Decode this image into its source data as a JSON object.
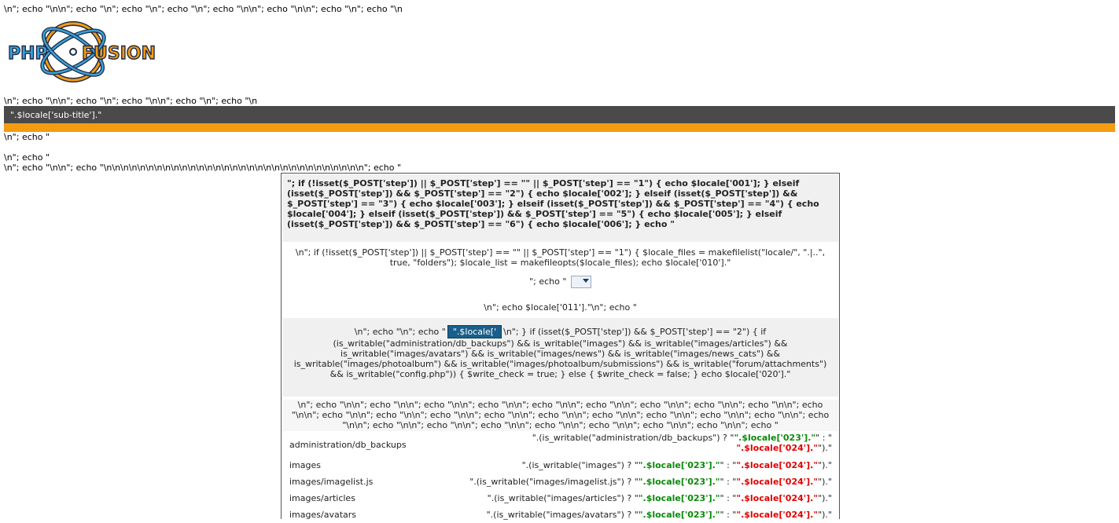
{
  "header": {
    "echo_line_1": "\\n\"; echo \"\\n\\n\"; echo \"\\n\"; echo \"\\n\"; echo \"\\n\"; echo \"\\n\\n\"; echo \"\\n\\n\"; echo \"\\n\"; echo \"\\n",
    "echo_line_2": "\\n\"; echo \"\\n\\n\"; echo \"\\n\"; echo \"\\n\\n\"; echo \"\\n\"; echo \"\\n",
    "logo_text_left": "PHP",
    "logo_text_right": "FUSION",
    "subtitle": "\".$locale['sub-title'].\"",
    "echo_line_3": "\\n\"; echo \"",
    "echo_line_4": "\\n\"; echo \"",
    "echo_line_5": "\\n\"; echo \"\\n\\n\"; echo \"\\n\\n\\n\\n\\n\\n\\n\\n\\n\\n\\n\\n\\n\\n\\n\\n\\n\\n\\n\\n\\n\\n\\n\\n\\n\\n\\n\\n\\n\\n\\n\"; echo \""
  },
  "panel": {
    "title": "\"; if (!isset($_POST['step']) || $_POST['step'] == \"\" || $_POST['step'] == \"1\") { echo $locale['001']; } elseif (isset($_POST['step']) && $_POST['step'] == \"2\") { echo $locale['002']; } elseif (isset($_POST['step']) && $_POST['step'] == \"3\") { echo $locale['003']; } elseif (isset($_POST['step']) && $_POST['step'] == \"4\") { echo $locale['004']; } elseif (isset($_POST['step']) && $_POST['step'] == \"5\") { echo $locale['005']; } elseif (isset($_POST['step']) && $_POST['step'] == \"6\") { echo $locale['006']; } echo \"",
    "files_text": "\\n\"; if (!isset($_POST['step']) || $_POST['step'] == \"\" || $_POST['step'] == \"1\") { $locale_files = makefilelist(\"locale/\", \".|..\", true, \"folders\"); $locale_list = makefileopts($locale_files); echo $locale['010'].\"",
    "select_prefix": "\"; echo \"",
    "echo_011": "\\n\"; echo $locale['011'].\"\\n\"; echo \"",
    "write_prefix": "\\n\"; echo \"\\n\"; echo \"",
    "button_label": "\".$locale['",
    "write_suffix": "\\n\"; } if (isset($_POST['step']) && $_POST['step'] == \"2\") { if (is_writable(\"administration/db_backups\") && is_writable(\"images\") && is_writable(\"images/articles\") && is_writable(\"images/avatars\") && is_writable(\"images/news\") && is_writable(\"images/news_cats\") && is_writable(\"images/photoalbum\") && is_writable(\"images/photoalbum/submissions\") && is_writable(\"forum/attachments\") && is_writable(\"config.php\")) { $write_check = true; } else { $write_check = false; } echo $locale['020'].\"",
    "echo_long": "\\n\"; echo \"\\n\\n\"; echo \"\\n\\n\"; echo \"\\n\\n\"; echo \"\\n\\n\"; echo \"\\n\\n\"; echo \"\\n\\n\"; echo \"\\n\\n\"; echo \"\\n\\n\"; echo \"\\n\\n\"; echo \"\\n\\n\"; echo \"\\n\\n\"; echo \"\\n\\n\"; echo \"\\n\\n\"; echo \"\\n\\n\"; echo \"\\n\\n\"; echo \"\\n\\n\"; echo \"\\n\\n\"; echo \"\\n\\n\"; echo \"\\n\\n\"; echo \"\\n\\n\"; echo \"\\n\\n\"; echo \"\\n\\n\"; echo \"\\n\\n\"; echo \"\\n\\n\"; echo \"\\n\\n\"; echo \"\\n\\n\"; echo \"\\n\\n\"; echo \"",
    "dirs": [
      {
        "name": "administration/db_backups",
        "expr_a": "\".(is_writable(\"administration/db_backups\") ? \"",
        "ok": "\".$locale['023'].\"",
        "mid": "\" : \"",
        "bad": "\".$locale['024'].\"",
        "tail": "\").\""
      },
      {
        "name": "images",
        "expr_a": "\".(is_writable(\"images\") ? \"",
        "ok": "\".$locale['023'].\"",
        "mid": "\" : \"",
        "bad": "\".$locale['024'].\"",
        "tail": "\").\""
      },
      {
        "name": "images/imagelist.js",
        "expr_a": "\".(is_writable(\"images/imagelist.js\") ? \"",
        "ok": "\".$locale['023'].\"",
        "mid": "\" : \"",
        "bad": "\".$locale['024'].\"",
        "tail": "\").\""
      },
      {
        "name": "images/articles",
        "expr_a": "\".(is_writable(\"images/articles\") ? \"",
        "ok": "\".$locale['023'].\"",
        "mid": "\" : \"",
        "bad": "\".$locale['024'].\"",
        "tail": "\").\""
      },
      {
        "name": "images/avatars",
        "expr_a": "\".(is_writable(\"images/avatars\") ? \"",
        "ok": "\".$locale['023'].\"",
        "mid": "\" : \"",
        "bad": "\".$locale['024'].\"",
        "tail": "\").\""
      }
    ]
  },
  "colors": {
    "header_bar": "#4a4a4a",
    "accent_bar": "#f39c12",
    "ok": "#0a8a0a",
    "bad": "#e00000",
    "button": "#1a5f8a"
  }
}
